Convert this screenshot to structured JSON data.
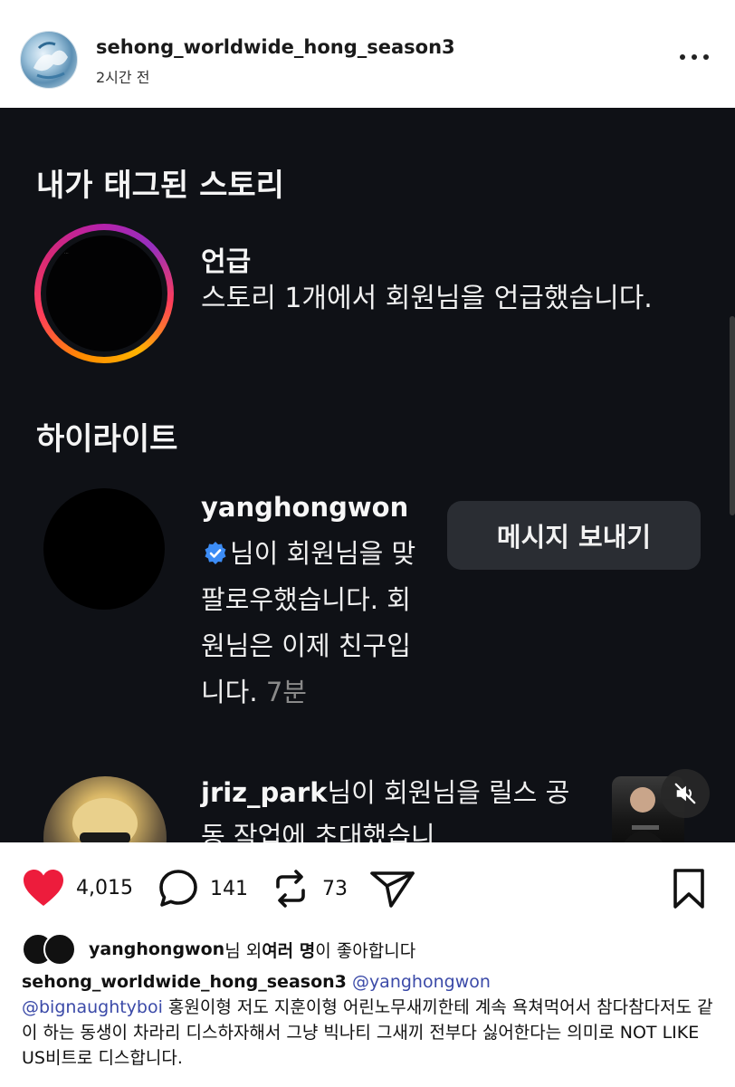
{
  "post": {
    "username": "sehong_worldwide_hong_season3",
    "time": "2시간 전"
  },
  "screenshot": {
    "tagged_title": "내가 태그된 스토리",
    "story_scribble": "...",
    "mention_title": "언급",
    "mention_text": "스토리 1개에서 회원님을 언급했습니다.",
    "highlight_title": "하이라이트",
    "follow": {
      "user": "yanghongwon",
      "text": "님이 회원님을 맞팔로우했습니다. 회원님은 이제 친구입니다.",
      "time": "7분",
      "button": "메시지 보내기"
    },
    "invite": {
      "user": "jriz_park",
      "text": "님이 회원님을 릴스 공동 작업에 초대했습니"
    }
  },
  "actions": {
    "likes": "4,015",
    "comments": "141",
    "reposts": "73"
  },
  "liked_by": {
    "user": "yanghongwon",
    "mid": "님 외 ",
    "bold": "여러 명",
    "end": "이 좋아합니다"
  },
  "caption": {
    "user": "sehong_worldwide_hong_season3",
    "mention1": "@yanghongwon",
    "mention2": "@bignaughtyboi",
    "text": " 홍원이형 저도 지훈이형 어린노무새끼한테 계속 욕쳐먹어서 참다참다저도 같이 하는 동생이 차라리 디스하자해서 그냥 빅나티 그새끼 전부다 싫어한다는 의미로 NOT LIKE US비트로 디스합니다."
  },
  "colors": {
    "heart": "#ed1c3c",
    "mention": "#3b4aa8",
    "screenshot_bg": "#0f1116"
  }
}
